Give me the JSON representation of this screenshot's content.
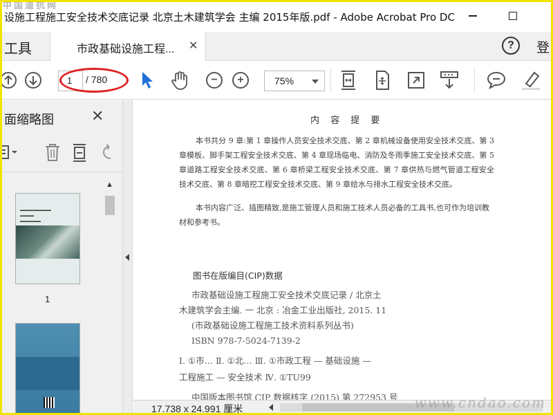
{
  "window": {
    "title": "设施工程施工安全技术交底记录 北京土木建筑学会 主编 2015年版.pdf - Adobe Acrobat Pro DC"
  },
  "watermarks": {
    "top": "中国道抗网",
    "bottom": "www.cndao.com"
  },
  "tabs": {
    "tools_label": "工具",
    "document_label": "市政基础设施工程...",
    "login_label": "登"
  },
  "toolbar": {
    "page_current": "1",
    "page_total": "/ 780",
    "zoom_value": "75%"
  },
  "left_pane": {
    "title": "面缩略图",
    "thumbnails": [
      {
        "page_label": "1"
      }
    ]
  },
  "document": {
    "heading": "内 容 提 要",
    "summary": "本书共分 9 章:第 1 章操作人员安全技术交底、第 2 章机械设备使用安全技术交底、第 3 章模板、脚手架工程安全技术交底、第 4 章现场临电、消防及冬雨季施工安全技术交底、第 5 章道路工程安全技术交底、第 6 章桥梁工程安全技术交底、第 7 章供热与燃气管道工程安全技术交底、第 8 章暗挖工程安全技术交底、第 9 章给水与排水工程安全技术交底。",
    "summary2": "本书内容广泛、插图精致,是施工管理人员和施工技术人员必备的工具书,也可作为培训教材和参考书。",
    "cip_title": "图书在版编目(CIP)数据",
    "cip_lines": [
      "市政基础设施工程施工安全技术交底记录 / 北京土",
      "木建筑学会主编. 一 北京 : 冶金工业出版社, 2015. 11",
      "(市政基础设施工程施工技术资料系列丛书)",
      "ISBN 978-7-5024-7139-2"
    ],
    "class_lines": [
      "Ⅰ. ①市… Ⅱ. ①北… Ⅲ. ①市政工程 — 基础设施 —",
      "工程施工 — 安全技术 Ⅳ. ①TU99"
    ],
    "cip_last": "中国版本图书馆 CIP 数据核字 (2015) 第 272953 号"
  },
  "status": {
    "dimensions": "17.738 x 24.991 厘米"
  },
  "colors": {
    "annotation_ellipse": "#e02020",
    "select_cursor": "#1f6fd6",
    "frame_border": "#f2e400"
  }
}
